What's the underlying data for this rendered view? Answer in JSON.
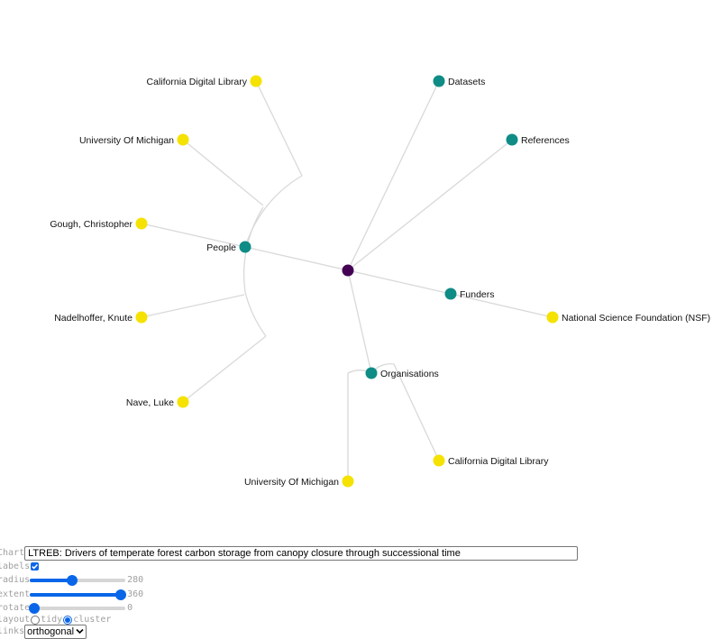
{
  "tree": {
    "root": {
      "color": "#440154"
    },
    "branch_color": "#0f8c85",
    "leaf_color": "#f5e200",
    "groups": [
      {
        "label": "Datasets",
        "children": []
      },
      {
        "label": "References",
        "children": []
      },
      {
        "label": "Funders",
        "children": [
          "National Science Foundation (NSF)"
        ]
      },
      {
        "label": "Organisations",
        "children": [
          "California Digital Library",
          "University Of Michigan"
        ]
      },
      {
        "label": "People",
        "children": [
          "Nave, Luke",
          "Nadelhoffer, Knute",
          "Gough, Christopher",
          "University Of Michigan",
          "California Digital Library"
        ]
      }
    ]
  },
  "controls": {
    "chart_label": "Chart",
    "chart_value": "LTREB: Drivers of temperate forest carbon storage from canopy closure through successional time",
    "labels_label": "labels",
    "labels_checked": true,
    "radius_label": "radius",
    "radius_value": "280",
    "radius_fraction": 0.44,
    "extent_label": "extent",
    "extent_value": "360",
    "extent_fraction": 0.95,
    "rotate_label": "rotate",
    "rotate_value": "0",
    "rotate_fraction": 0.05,
    "layout_label": "layout",
    "layout_options": [
      "tidy",
      "cluster"
    ],
    "layout_selected": "cluster",
    "links_label": "links",
    "links_value": "orthogonal"
  }
}
